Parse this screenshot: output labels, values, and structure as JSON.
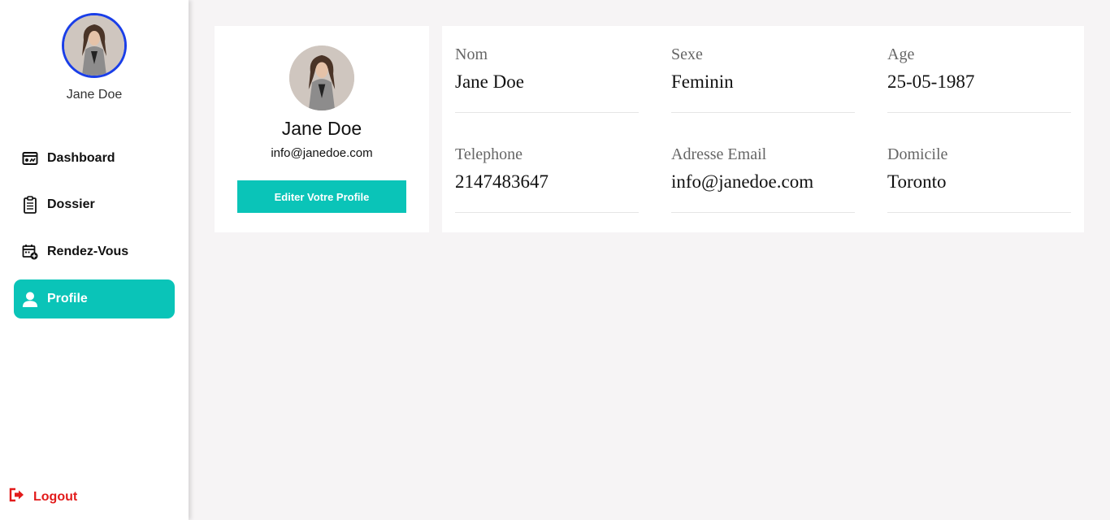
{
  "user": {
    "name": "Jane Doe",
    "email": "info@janedoe.com"
  },
  "nav": [
    {
      "label": "Dashboard",
      "icon": "dashboard-icon",
      "active": false
    },
    {
      "label": "Dossier",
      "icon": "clipboard-icon",
      "active": false
    },
    {
      "label": "Rendez-Vous",
      "icon": "calendar-icon",
      "active": false
    },
    {
      "label": "Profile",
      "icon": "user-icon",
      "active": true
    }
  ],
  "logout": {
    "label": "Logout",
    "icon": "logout-icon"
  },
  "profile_card": {
    "edit_label": "Editer Votre Profile"
  },
  "fields": [
    {
      "label": "Nom",
      "value": "Jane Doe"
    },
    {
      "label": "Sexe",
      "value": "Feminin"
    },
    {
      "label": "Age",
      "value": "25-05-1987"
    },
    {
      "label": "Telephone",
      "value": "2147483647"
    },
    {
      "label": "Adresse Email",
      "value": "info@janedoe.com"
    },
    {
      "label": "Domicile",
      "value": "Toronto"
    }
  ],
  "colors": {
    "accent": "#0ac4b8",
    "avatar_border": "#1a3ee8",
    "logout": "#e21b1b",
    "background": "#f6f4f5"
  }
}
